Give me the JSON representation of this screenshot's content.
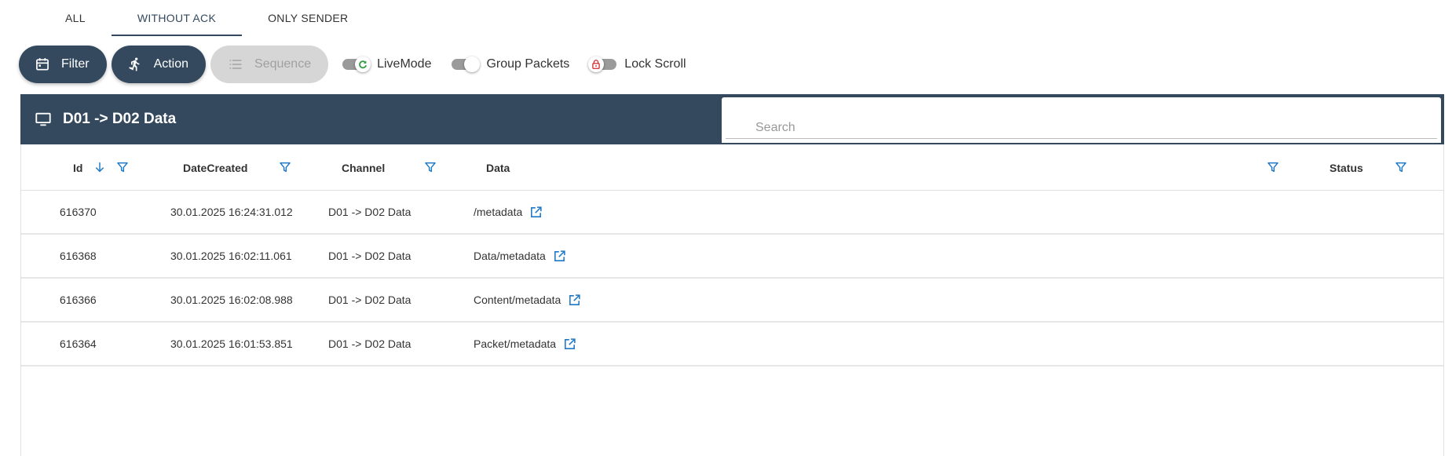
{
  "tabs": [
    {
      "label": "ALL",
      "active": false
    },
    {
      "label": "WITHOUT ACK",
      "active": true
    },
    {
      "label": "ONLY SENDER",
      "active": false
    }
  ],
  "toolbar": {
    "filter_label": "Filter",
    "action_label": "Action",
    "sequence_label": "Sequence",
    "livemode_label": "LiveMode",
    "group_packets_label": "Group Packets",
    "lock_scroll_label": "Lock Scroll"
  },
  "panel": {
    "title": "D01 -> D02 Data",
    "search_placeholder": "Search"
  },
  "table": {
    "columns": {
      "id": "Id",
      "date_created": "DateCreated",
      "channel": "Channel",
      "data": "Data",
      "status": "Status"
    },
    "rows": [
      {
        "id": "616370",
        "date_created": "30.01.2025 16:24:31.012",
        "channel": "D01 -> D02 Data",
        "data": "/metadata",
        "status": ""
      },
      {
        "id": "616368",
        "date_created": "30.01.2025 16:02:11.061",
        "channel": "D01 -> D02 Data",
        "data": "Data/metadata",
        "status": ""
      },
      {
        "id": "616366",
        "date_created": "30.01.2025 16:02:08.988",
        "channel": "D01 -> D02 Data",
        "data": "Content/metadata",
        "status": ""
      },
      {
        "id": "616364",
        "date_created": "30.01.2025 16:01:53.851",
        "channel": "D01 -> D02 Data",
        "data": "Packet/metadata",
        "status": ""
      }
    ]
  },
  "colors": {
    "primary": "#34495e",
    "accent_blue": "#1e78c8",
    "live_green": "#2e9e3e",
    "lock_red": "#d0262d",
    "disabled": "#d6d6d6"
  }
}
